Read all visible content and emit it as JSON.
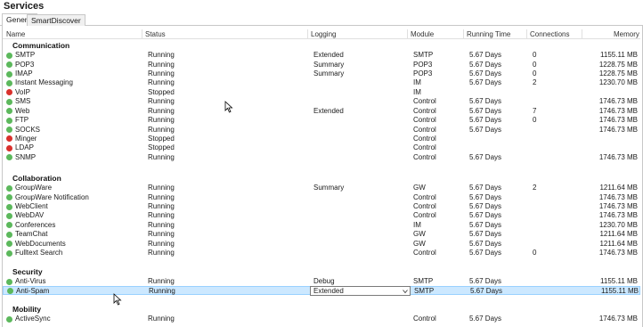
{
  "window": {
    "title": "Services"
  },
  "tabs": [
    {
      "label": "General",
      "active": true
    },
    {
      "label": "SmartDiscover",
      "active": false
    }
  ],
  "columns": [
    "Name",
    "Status",
    "Logging",
    "Module",
    "Running Time",
    "Connections",
    "Memory"
  ],
  "colors": {
    "running": "#5cb85c",
    "stopped": "#d9302c",
    "selected_bg": "#cce8ff"
  },
  "groups": [
    {
      "name": "Communication",
      "rows": [
        {
          "name": "SMTP",
          "state": "running",
          "status": "Running",
          "logging": "Extended",
          "module": "SMTP",
          "time": "5.67 Days",
          "connections": "0",
          "memory": "1155.11 MB"
        },
        {
          "name": "POP3",
          "state": "running",
          "status": "Running",
          "logging": "Summary",
          "module": "POP3",
          "time": "5.67 Days",
          "connections": "0",
          "memory": "1228.75 MB"
        },
        {
          "name": "IMAP",
          "state": "running",
          "status": "Running",
          "logging": "Summary",
          "module": "POP3",
          "time": "5.67 Days",
          "connections": "0",
          "memory": "1228.75 MB"
        },
        {
          "name": "Instant Messaging",
          "state": "running",
          "status": "Running",
          "logging": "",
          "module": "IM",
          "time": "5.67 Days",
          "connections": "2",
          "memory": "1230.70 MB"
        },
        {
          "name": "VoIP",
          "state": "stopped",
          "status": "Stopped",
          "logging": "",
          "module": "IM",
          "time": "",
          "connections": "",
          "memory": ""
        },
        {
          "name": "SMS",
          "state": "running",
          "status": "Running",
          "logging": "",
          "module": "Control",
          "time": "5.67 Days",
          "connections": "",
          "memory": "1746.73 MB"
        },
        {
          "name": "Web",
          "state": "running",
          "status": "Running",
          "logging": "Extended",
          "module": "Control",
          "time": "5.67 Days",
          "connections": "7",
          "memory": "1746.73 MB"
        },
        {
          "name": "FTP",
          "state": "running",
          "status": "Running",
          "logging": "",
          "module": "Control",
          "time": "5.67 Days",
          "connections": "0",
          "memory": "1746.73 MB"
        },
        {
          "name": "SOCKS",
          "state": "running",
          "status": "Running",
          "logging": "",
          "module": "Control",
          "time": "5.67 Days",
          "connections": "",
          "memory": "1746.73 MB"
        },
        {
          "name": "Minger",
          "state": "stopped",
          "status": "Stopped",
          "logging": "",
          "module": "Control",
          "time": "",
          "connections": "",
          "memory": ""
        },
        {
          "name": "LDAP",
          "state": "stopped",
          "status": "Stopped",
          "logging": "",
          "module": "Control",
          "time": "",
          "connections": "",
          "memory": ""
        },
        {
          "name": "SNMP",
          "state": "running",
          "status": "Running",
          "logging": "",
          "module": "Control",
          "time": "5.67 Days",
          "connections": "",
          "memory": "1746.73 MB"
        }
      ]
    },
    {
      "name": "Collaboration",
      "rows": [
        {
          "name": "GroupWare",
          "state": "running",
          "status": "Running",
          "logging": "Summary",
          "module": "GW",
          "time": "5.67 Days",
          "connections": "2",
          "memory": "1211.64 MB"
        },
        {
          "name": "GroupWare Notification",
          "state": "running",
          "status": "Running",
          "logging": "",
          "module": "Control",
          "time": "5.67 Days",
          "connections": "",
          "memory": "1746.73 MB"
        },
        {
          "name": "WebClient",
          "state": "running",
          "status": "Running",
          "logging": "",
          "module": "Control",
          "time": "5.67 Days",
          "connections": "",
          "memory": "1746.73 MB"
        },
        {
          "name": "WebDAV",
          "state": "running",
          "status": "Running",
          "logging": "",
          "module": "Control",
          "time": "5.67 Days",
          "connections": "",
          "memory": "1746.73 MB"
        },
        {
          "name": "Conferences",
          "state": "running",
          "status": "Running",
          "logging": "",
          "module": "IM",
          "time": "5.67 Days",
          "connections": "",
          "memory": "1230.70 MB"
        },
        {
          "name": "TeamChat",
          "state": "running",
          "status": "Running",
          "logging": "",
          "module": "GW",
          "time": "5.67 Days",
          "connections": "",
          "memory": "1211.64 MB"
        },
        {
          "name": "WebDocuments",
          "state": "running",
          "status": "Running",
          "logging": "",
          "module": "GW",
          "time": "5.67 Days",
          "connections": "",
          "memory": "1211.64 MB"
        },
        {
          "name": "Fulltext Search",
          "state": "running",
          "status": "Running",
          "logging": "",
          "module": "Control",
          "time": "5.67 Days",
          "connections": "0",
          "memory": "1746.73 MB"
        }
      ]
    },
    {
      "name": "Security",
      "rows": [
        {
          "name": "Anti-Virus",
          "state": "running",
          "status": "Running",
          "logging": "Debug",
          "module": "SMTP",
          "time": "5.67 Days",
          "connections": "",
          "memory": "1155.11 MB"
        },
        {
          "name": "Anti-Spam",
          "state": "running",
          "status": "Running",
          "logging": "Extended",
          "module": "SMTP",
          "time": "5.67 Days",
          "connections": "",
          "memory": "1155.11 MB",
          "selected": true
        }
      ]
    },
    {
      "name": "Mobility",
      "rows": [
        {
          "name": "ActiveSync",
          "state": "running",
          "status": "Running",
          "logging": "",
          "module": "Control",
          "time": "5.67 Days",
          "connections": "",
          "memory": "1746.73 MB"
        }
      ]
    }
  ]
}
